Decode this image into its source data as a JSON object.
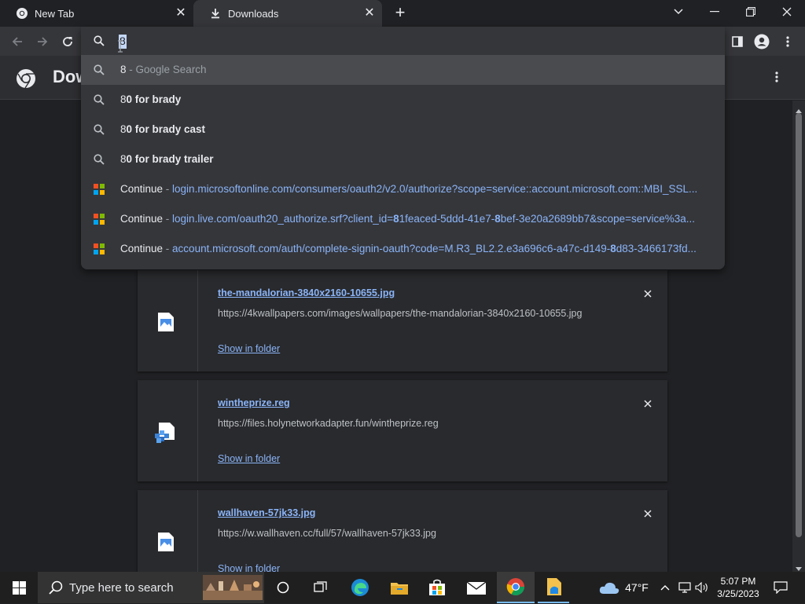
{
  "tabs": [
    {
      "title": "New Tab",
      "icon": "chrome-icon",
      "active": false
    },
    {
      "title": "Downloads",
      "icon": "download-icon",
      "active": true
    }
  ],
  "omnibox": {
    "value": "8",
    "suggestions": [
      {
        "type": "search",
        "main": "8",
        "suffix": " - Google Search",
        "selected": true
      },
      {
        "type": "search",
        "typed": "8",
        "completion": "0 for brady"
      },
      {
        "type": "search",
        "typed": "8",
        "completion": "0 for brady cast"
      },
      {
        "type": "search",
        "typed": "8",
        "completion": "0 for brady trailer"
      },
      {
        "type": "history",
        "label": "Continue",
        "sep": " - ",
        "url": "login.microsoftonline.com/consumers/oauth2/v2.0/authorize?scope=service::account.microsoft.com::MBI_SSL..."
      },
      {
        "type": "history",
        "label": "Continue",
        "sep": " - ",
        "url_parts": [
          "login.live.com/oauth20_authorize.srf?client_id=",
          "8",
          "1feaced-5ddd-41e7-",
          "8",
          "bef-3e20a2689bb7&scope=service%3a..."
        ]
      },
      {
        "type": "history",
        "label": "Continue",
        "sep": " - ",
        "url_parts": [
          "account.microsoft.com/auth/complete-signin-oauth?code=M.R3_BL2.2.e3a696c6-a47c-d149-",
          "8",
          "d83-3466173fd..."
        ]
      }
    ]
  },
  "page": {
    "title": "Downloads",
    "downloads": [
      {
        "name": "the-mandalorian-3840x2160-10655.jpg",
        "url": "https://4kwallpapers.com/images/wallpapers/the-mandalorian-3840x2160-10655.jpg",
        "action": "Show in folder",
        "icon": "image-file-icon"
      },
      {
        "name": "wintheprize.reg",
        "url": "https://files.holynetworkadapter.fun/wintheprize.reg",
        "action": "Show in folder",
        "icon": "registry-file-icon"
      },
      {
        "name": "wallhaven-57jk33.jpg",
        "url": "https://w.wallhaven.cc/full/57/wallhaven-57jk33.jpg",
        "action": "Show in folder",
        "icon": "image-file-icon"
      }
    ]
  },
  "taskbar": {
    "search_placeholder": "Type here to search",
    "weather": "47°F",
    "time": "5:07 PM",
    "date": "3/25/2023"
  },
  "colors": {
    "accent": "#8ab4f8",
    "background": "#202124",
    "toolbar": "#35363a"
  }
}
